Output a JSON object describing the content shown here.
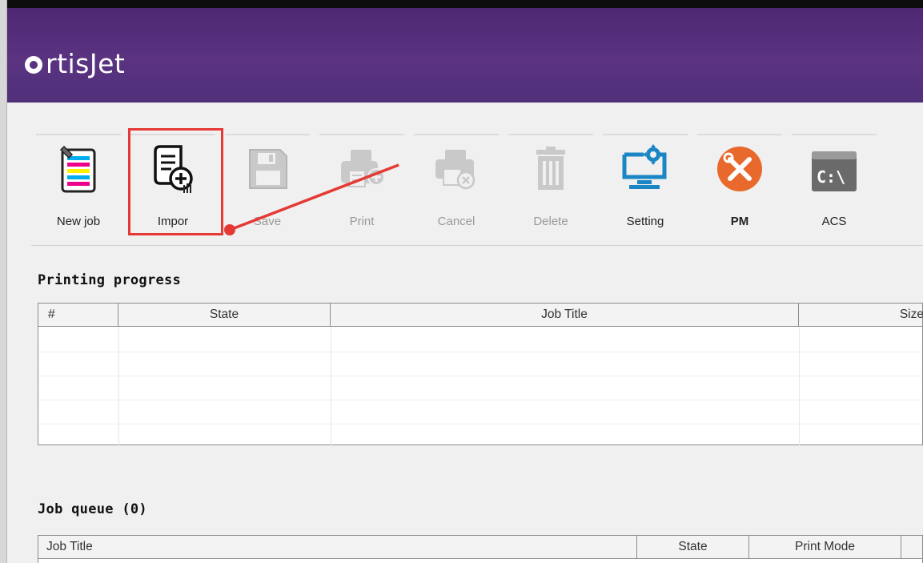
{
  "app": {
    "logo_text": "rtisJet",
    "logo_name": "OrtisJet"
  },
  "toolbar": {
    "items": [
      {
        "label": "New job",
        "icon": "new-job-icon",
        "state": "enabled"
      },
      {
        "label": "Impor",
        "icon": "import-icon",
        "state": "enabled"
      },
      {
        "label": "Save",
        "icon": "save-icon",
        "state": "disabled"
      },
      {
        "label": "Print",
        "icon": "print-icon",
        "state": "disabled"
      },
      {
        "label": "Cancel",
        "icon": "cancel-print-icon",
        "state": "disabled"
      },
      {
        "label": "Delete",
        "icon": "trash-icon",
        "state": "disabled"
      },
      {
        "label": "Setting",
        "icon": "monitor-gear-icon",
        "state": "enabled"
      },
      {
        "label": "PM",
        "icon": "tools-icon",
        "state": "enabled"
      },
      {
        "label": "ACS",
        "icon": "command-prompt-icon",
        "state": "enabled"
      }
    ]
  },
  "printing_progress": {
    "title": "Printing progress",
    "columns": [
      "#",
      "State",
      "Job Title",
      "Size"
    ],
    "rows": []
  },
  "job_queue": {
    "title": "Job queue (0)",
    "columns": [
      "Job Title",
      "State",
      "Print Mode"
    ],
    "rows": []
  },
  "annotation": {
    "highlight": "Import button",
    "color": "#e53935"
  },
  "colors": {
    "brand": "#54307c",
    "annotation": "#e53935",
    "setting_blue": "#1b86c4",
    "pm_orange": "#e8692b"
  }
}
